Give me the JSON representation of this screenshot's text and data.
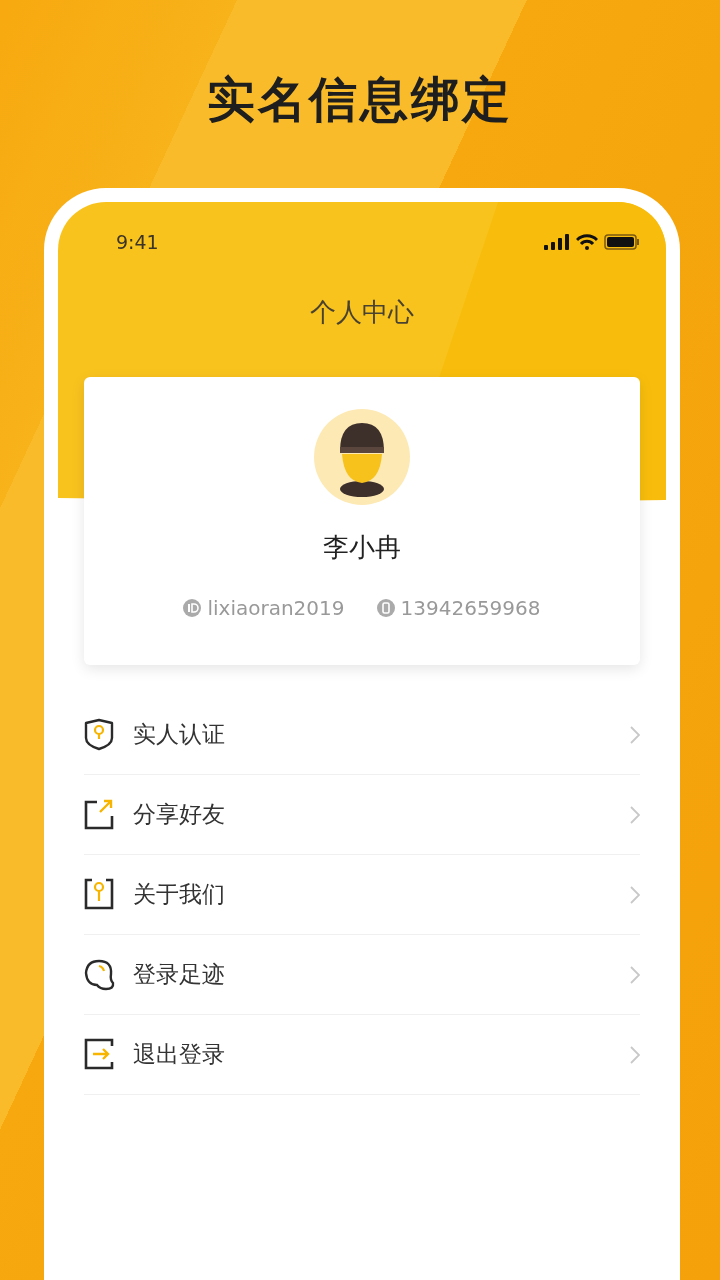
{
  "promo_title": "实名信息绑定",
  "status_bar": {
    "time": "9:41"
  },
  "page_title": "个人中心",
  "profile": {
    "name": "李小冉",
    "username": "lixiaoran2019",
    "phone": "13942659968"
  },
  "menu": [
    {
      "label": "实人认证"
    },
    {
      "label": "分享好友"
    },
    {
      "label": "关于我们"
    },
    {
      "label": "登录足迹"
    },
    {
      "label": "退出登录"
    }
  ]
}
